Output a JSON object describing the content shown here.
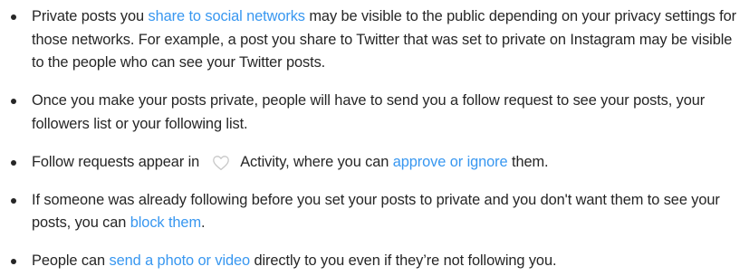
{
  "bullets": [
    {
      "pre": "Private posts you ",
      "link": "share to social networks",
      "post": " may be visible to the public depending on your privacy settings for those networks. For example, a post you share to Twitter that was set to private on Instagram may be visible to the people who can see your Twitter posts."
    },
    {
      "text": "Once you make your posts private, people will have to send you a follow request to see your posts, your followers list or your following list."
    },
    {
      "pre": "Follow requests appear in ",
      "icon": "heart-icon",
      "mid": " Activity, where you can ",
      "link": "approve or ignore",
      "post": " them."
    },
    {
      "pre": "If someone was already following before you set your posts to private and you don't want them to see your posts, you can ",
      "link": "block them",
      "post": "."
    },
    {
      "pre": "People can ",
      "link": "send a photo or video",
      "post": " directly to you even if they’re not following you."
    }
  ],
  "colors": {
    "text": "#262626",
    "link": "#3897f0",
    "icon_stroke": "#c7c7c7"
  }
}
